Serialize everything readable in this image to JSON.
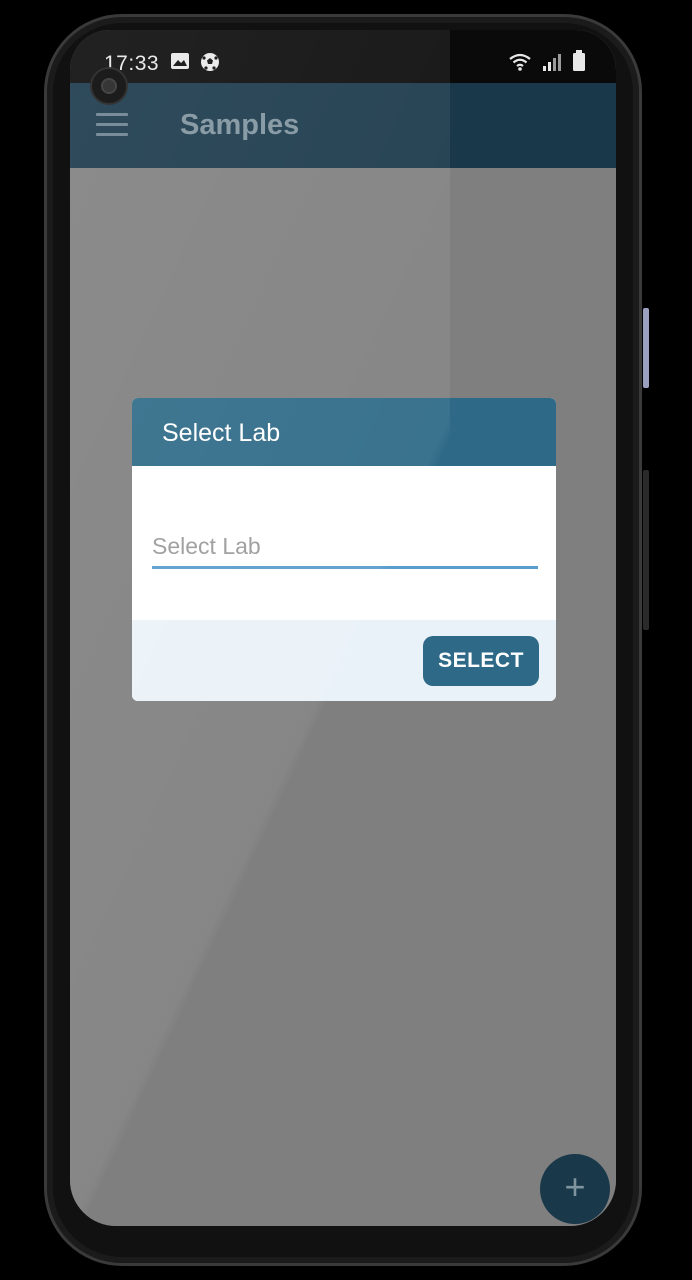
{
  "statusbar": {
    "time": "17:33",
    "left_icons": [
      "image-icon",
      "soccer-ball-icon"
    ],
    "right_icons": [
      "wifi-icon",
      "signal-icon",
      "battery-icon"
    ]
  },
  "appbar": {
    "title": "Samples",
    "menu_icon": "hamburger-menu-icon"
  },
  "dialog": {
    "title": "Select Lab",
    "input": {
      "placeholder": "Select Lab",
      "value": ""
    },
    "select_label": "SELECT"
  },
  "fab": {
    "icon": "plus-icon",
    "glyph": "+"
  },
  "colors": {
    "appbar": "#19384a",
    "dialog_header": "#2e6a87",
    "accent_underline": "#5a9ccc",
    "scrim": "#7f7f7f",
    "footer": "#eaf2f9"
  }
}
